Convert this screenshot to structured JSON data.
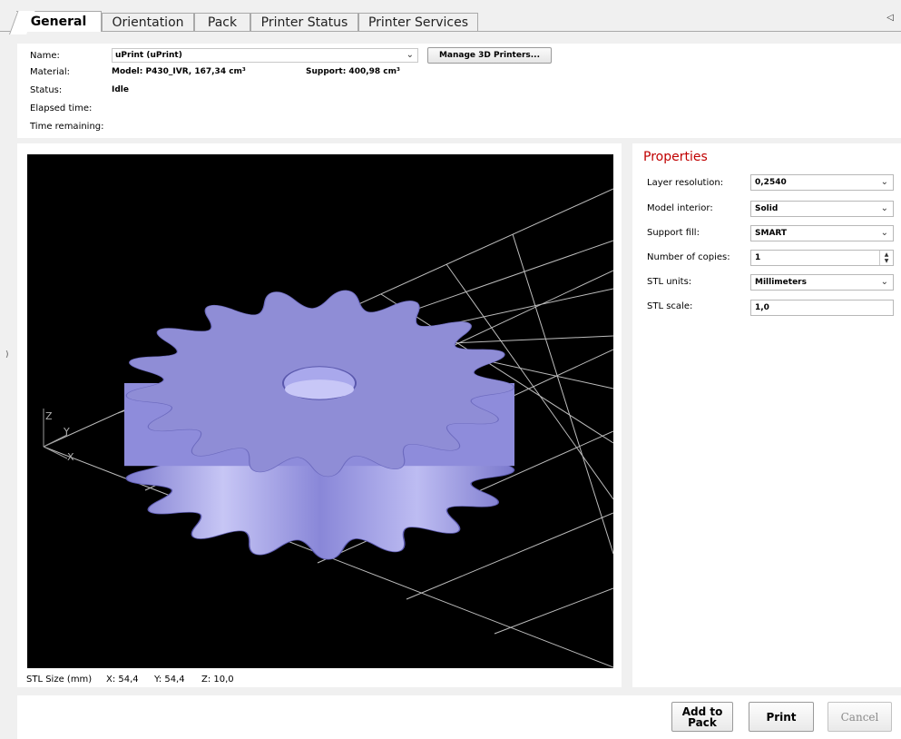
{
  "tabs": [
    {
      "label": "General",
      "active": true
    },
    {
      "label": "Orientation",
      "active": false
    },
    {
      "label": "Pack",
      "active": false
    },
    {
      "label": "Printer Status",
      "active": false
    },
    {
      "label": "Printer Services",
      "active": false
    }
  ],
  "tab_overflow_icon": "triangle-left-icon",
  "general": {
    "name_label": "Name:",
    "name_value": "uPrint (uPrint)",
    "manage_button": "Manage 3D Printers...",
    "material_label": "Material:",
    "material_value": "Model: P430_IVR, 167,34 cm³",
    "support_value": "Support: 400,98 cm³",
    "status_label": "Status:",
    "status_value": "Idle",
    "elapsed_label": "Elapsed time:",
    "elapsed_value": "",
    "remaining_label": "Time remaining:",
    "remaining_value": ""
  },
  "viewport": {
    "axis_z": "Z",
    "axis_y": "Y",
    "axis_x": "X",
    "model_color": "#9a98e0",
    "background": "#000000"
  },
  "stl_size": {
    "label": "STL Size (mm)",
    "x": "X: 54,4",
    "y": "Y: 54,4",
    "z": "Z: 10,0"
  },
  "properties": {
    "title": "Properties",
    "title_color": "#c00000",
    "items": [
      {
        "label": "Layer resolution:",
        "value": "0,2540",
        "control": "dropdown"
      },
      {
        "label": "Model interior:",
        "value": "Solid",
        "control": "dropdown"
      },
      {
        "label": "Support fill:",
        "value": "SMART",
        "control": "dropdown"
      },
      {
        "label": "Number of copies:",
        "value": "1",
        "control": "spinner"
      },
      {
        "label": "STL units:",
        "value": "Millimeters",
        "control": "dropdown"
      },
      {
        "label": "STL scale:",
        "value": "1,0",
        "control": "text"
      }
    ]
  },
  "actions": {
    "add_to_pack_line1": "Add to",
    "add_to_pack_line2": "Pack",
    "print": "Print",
    "cancel": "Cancel"
  }
}
